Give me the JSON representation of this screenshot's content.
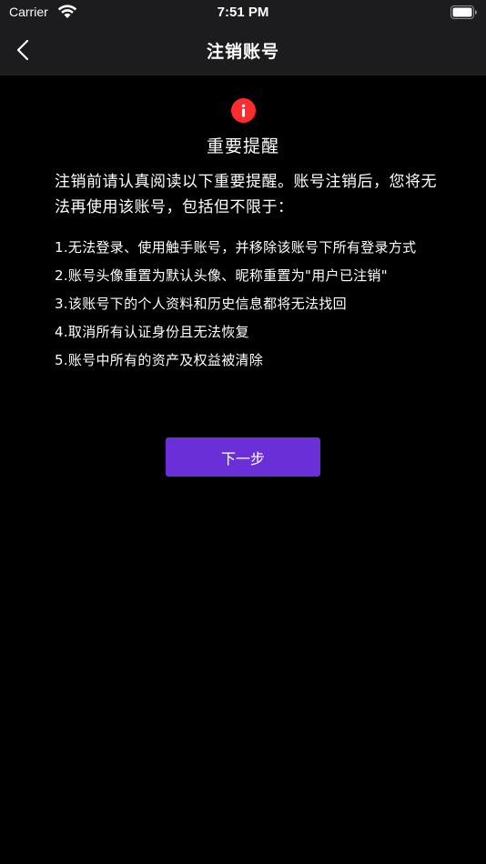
{
  "status_bar": {
    "carrier": "Carrier",
    "time": "7:51 PM",
    "icons": [
      "wifi-icon",
      "battery-icon"
    ]
  },
  "nav": {
    "back_icon": "chevron-left-icon",
    "title": "注销账号"
  },
  "notice": {
    "icon": "info-alert-icon",
    "icon_color": "#ff2d2d",
    "heading": "重要提醒",
    "intro": "注销前请认真阅读以下重要提醒。账号注销后，您将无法再使用该账号，包括但不限于：",
    "items": [
      "1.无法登录、使用触手账号，并移除该账号下所有登录方式",
      "2.账号头像重置为默认头像、昵称重置为\"用户已注销\"",
      "3.该账号下的个人资料和历史信息都将无法找回",
      "4.取消所有认证身份且无法恢复",
      "5.账号中所有的资产及权益被清除"
    ]
  },
  "actions": {
    "next_label": "下一步",
    "next_color": "#6a2fd6"
  },
  "colors": {
    "background": "#000000",
    "header_background": "#1c1c1e",
    "text": "#ffffff"
  }
}
